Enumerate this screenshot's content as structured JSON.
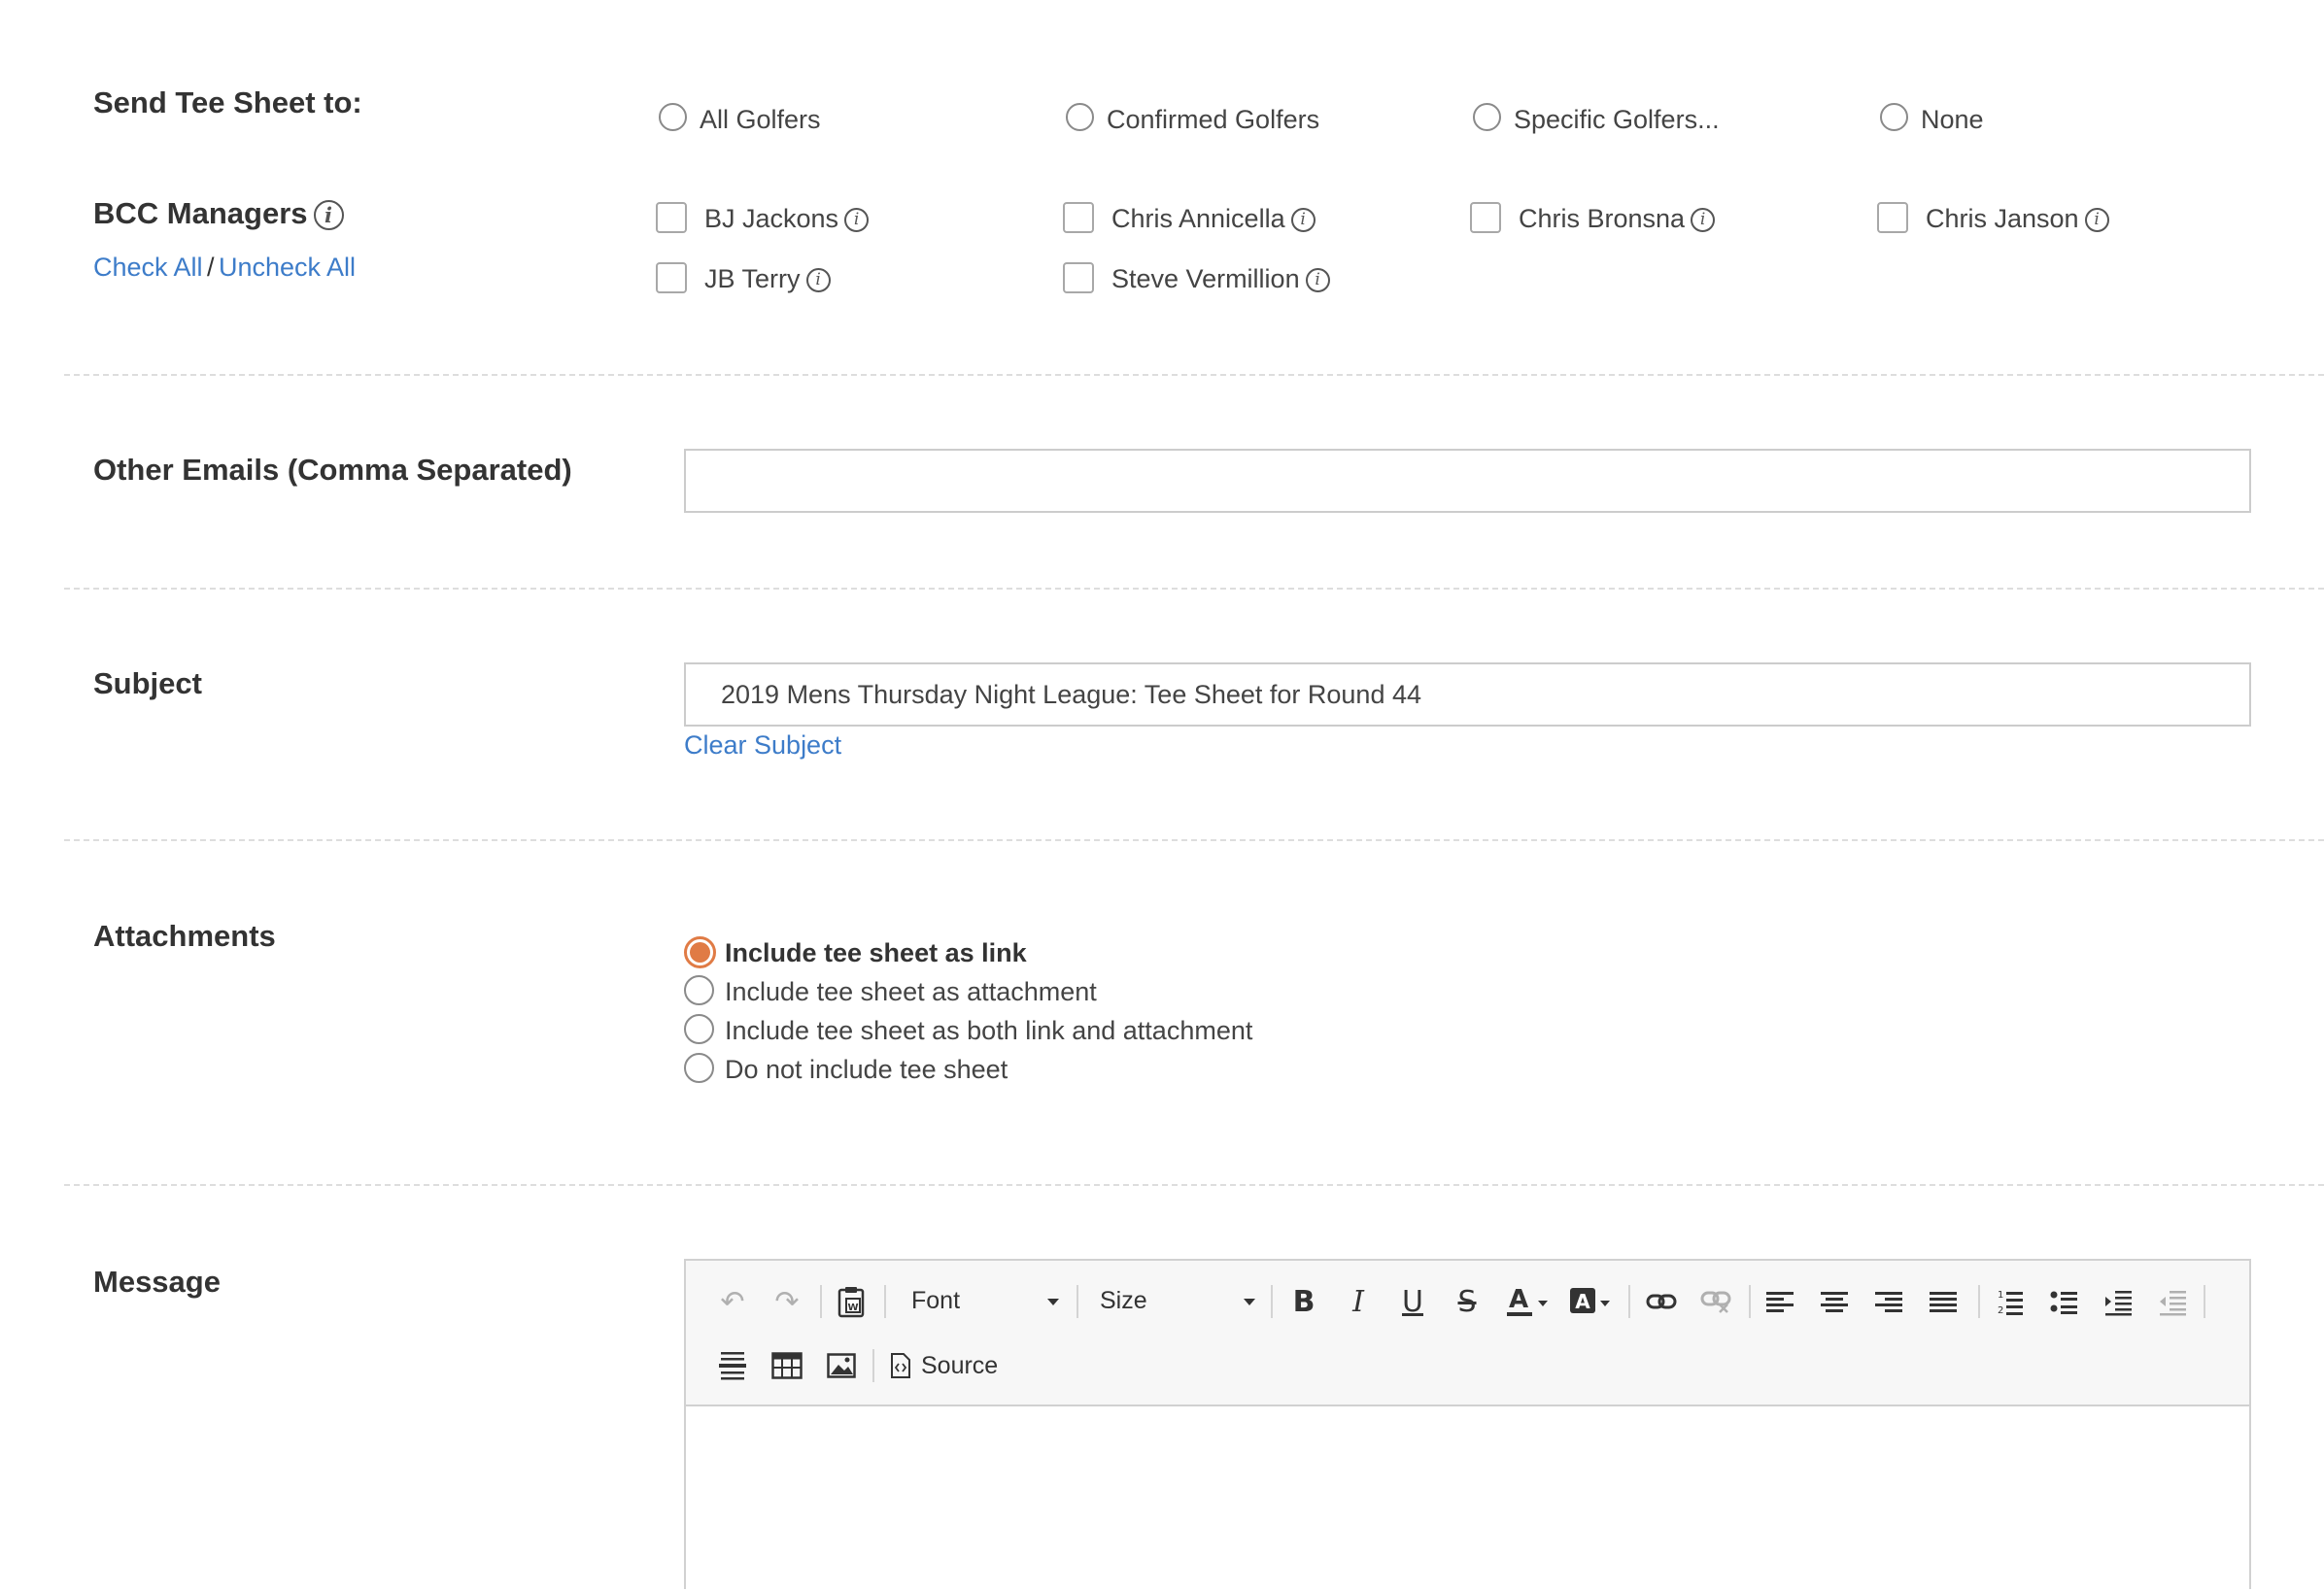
{
  "send_tee_sheet": {
    "label": "Send Tee Sheet to:",
    "options": [
      "All Golfers",
      "Confirmed Golfers",
      "Specific Golfers...",
      "None"
    ]
  },
  "bcc": {
    "label": "BCC Managers",
    "info_icon": "info-icon",
    "check_all": "Check All",
    "separator": "/",
    "uncheck_all": "Uncheck All",
    "managers": [
      "BJ Jackons",
      "Chris Annicella",
      "Chris Bronsna",
      "Chris Janson",
      "JB Terry",
      "Steve Vermillion"
    ]
  },
  "other_emails": {
    "label": "Other Emails (Comma Separated)",
    "value": ""
  },
  "subject": {
    "label": "Subject",
    "value": "2019 Mens Thursday Night League: Tee Sheet for Round 44",
    "clear": "Clear Subject"
  },
  "attachments": {
    "label": "Attachments",
    "options": [
      "Include tee sheet as link",
      "Include tee sheet as attachment",
      "Include tee sheet as both link and attachment",
      "Do not include tee sheet"
    ],
    "selected_index": 0
  },
  "message": {
    "label": "Message",
    "toolbar": {
      "font": "Font",
      "size": "Size",
      "source": "Source",
      "icons": [
        "undo-icon",
        "redo-icon",
        "paste-from-word-icon",
        "bold-icon",
        "italic-icon",
        "underline-icon",
        "strikethrough-icon",
        "text-color-icon",
        "background-color-icon",
        "link-icon",
        "unlink-icon",
        "align-left-icon",
        "align-center-icon",
        "align-right-icon",
        "justify-icon",
        "numbered-list-icon",
        "bulleted-list-icon",
        "indent-icon",
        "outdent-icon",
        "horizontal-line-icon",
        "table-icon",
        "image-icon",
        "source-icon"
      ]
    },
    "accent_color": "#e07b45",
    "link_color": "#3d7cc9"
  }
}
